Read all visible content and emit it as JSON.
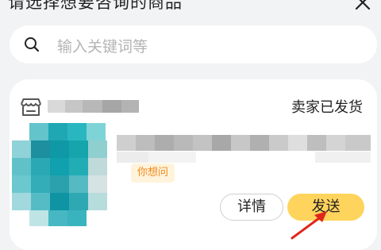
{
  "header": {
    "title": "请选择想要咨询的商品"
  },
  "search": {
    "placeholder": "输入关键词等"
  },
  "order": {
    "status": "卖家已发货",
    "ask_tag": "你想问",
    "details_label": "详情",
    "send_label": "发送"
  },
  "colors": {
    "send_button": "#ffd45c",
    "ask_tag_text": "#f08a1c",
    "annotation_arrow": "#e0261b"
  },
  "icons": {
    "close": "close-icon",
    "search": "search-icon",
    "shop": "shop-icon"
  }
}
